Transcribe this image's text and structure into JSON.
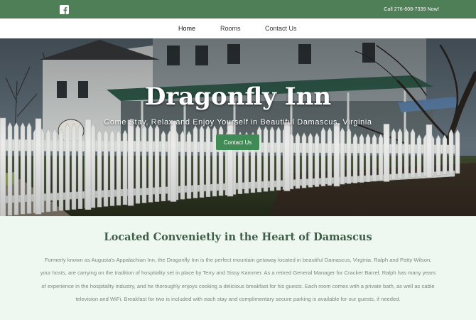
{
  "topbar": {
    "facebook_icon": "facebook-icon",
    "call_text": "Call 276-608-7339 Now!",
    "background_color": "#4f7f57"
  },
  "nav": {
    "items": [
      {
        "label": "Home"
      },
      {
        "label": "Rooms"
      },
      {
        "label": "Contact Us"
      }
    ]
  },
  "hero": {
    "title": "Dragonfly Inn",
    "subtitle": "Come Stay, Relax and Enjoy Yourself in Beautiful Damascus, Virginia",
    "button_label": "Contact Us",
    "button_color": "#3f8a55"
  },
  "about": {
    "heading": "Located Convenietly in the Heart of Damascus",
    "body": "Formerly known as Augusta's Appalachian Inn, the Dragonfly Inn is the perfect mountain getaway located in beautiful Damascus, Virginia. Ralph and Patty Wilson, your hosts, are carrying on the tradition of hospitality set in place by Terry and Sissy Kammer. As a retired General Manager for Cracker Barrel, Ralph has many years of experience in the hospitality industry, and he thoroughly enjoys cooking a delicious breakfast for his guests. Each room comes with a private bath, as well as cable television and WiFi. Breakfast for two is included with each stay and complimentary secure parking is available for our guests, if needed."
  }
}
